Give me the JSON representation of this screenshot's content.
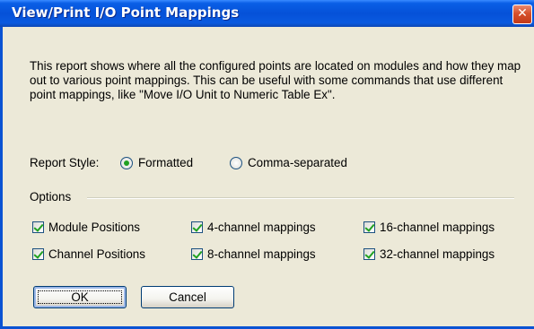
{
  "window": {
    "title": "View/Print I/O Point Mappings",
    "close_symbol": "✕"
  },
  "description": "This report shows where all the configured points are located on modules and how they map out to various point mappings. This can be useful with some commands that use different point mappings, like \"Move I/O Unit to Numeric Table Ex\".",
  "report_style": {
    "label": "Report Style:",
    "options": [
      {
        "label": "Formatted",
        "selected": true
      },
      {
        "label": "Comma-separated",
        "selected": false
      }
    ]
  },
  "options": {
    "group_label": "Options",
    "checkboxes": [
      {
        "label": "Module Positions",
        "checked": true
      },
      {
        "label": "4-channel mappings",
        "checked": true
      },
      {
        "label": "16-channel mappings",
        "checked": true
      },
      {
        "label": "Channel Positions",
        "checked": true
      },
      {
        "label": "8-channel mappings",
        "checked": true
      },
      {
        "label": "32-channel mappings",
        "checked": true
      }
    ]
  },
  "buttons": {
    "ok": "OK",
    "cancel": "Cancel"
  },
  "colors": {
    "titlebar": "#0551d8",
    "dialog_background": "#ece9d8",
    "close_button": "#d6502c",
    "check_mark": "#21a121"
  }
}
